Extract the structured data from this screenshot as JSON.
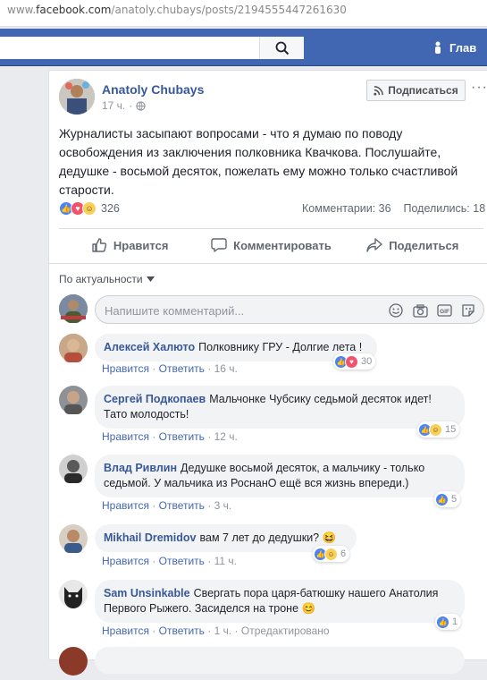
{
  "browser": {
    "url_prefix": "www.",
    "url_host": "facebook.com",
    "url_path": "/anatoly.chubays/posts/2194555447261630"
  },
  "topbar": {
    "search_placeholder": "",
    "nav_home": "Глав"
  },
  "post": {
    "author": "Anatoly Chubays",
    "time": "17 ч.",
    "subscribe_label": "Подписаться",
    "text": "Журналисты засыпают вопросами - что я думаю по поводу освобождения из заключения полковника Квачкова. Послушайте, дедушке - восьмой десяток, пожелать ему можно только счастливой старости.",
    "reaction_count": "326",
    "comments_label": "Комментарии: 36",
    "shares_label": "Поделились: 18",
    "like_label": "Нравится",
    "comment_label": "Комментировать",
    "share_label": "Поделиться"
  },
  "comments_section": {
    "sort_label": "По актуальности",
    "composer_placeholder": "Напишите комментарий..."
  },
  "comments": [
    {
      "name": "Алексей Халюто",
      "text": "Полковнику ГРУ - Долгие лета !",
      "like": "Нравится",
      "reply": "Ответить",
      "time": "16 ч.",
      "reactions": "30",
      "avatar_color": "#b08a6a"
    },
    {
      "name": "Сергей Подкопаев",
      "text": "Мальчонке Чубсику седьмой десяток идет! Тато молодость!",
      "like": "Нравится",
      "reply": "Ответить",
      "time": "12 ч.",
      "reactions": "15",
      "avatar_color": "#7a7d80"
    },
    {
      "name": "Влад Ривлин",
      "text": "Дедушке восьмой десяток, а мальчику - только седьмой. У мальчика из РоснанО ещё вся жизнь впереди.)",
      "like": "Нравится",
      "reply": "Ответить",
      "time": "3 ч.",
      "reactions": "5",
      "avatar_color": "#4a4a4a"
    },
    {
      "name": "Mikhail Dremidov",
      "text": "вам 7 лет до дедушки?",
      "like": "Нравится",
      "reply": "Ответить",
      "time": "11 ч.",
      "reactions": "6",
      "avatar_color": "#a58870"
    },
    {
      "name": "Sam Unsinkable",
      "text": "Свергать пора царя-батюшку нашего Анатолия Первого Рыжего. Засиделся на троне",
      "like": "Нравится",
      "reply": "Ответить",
      "time": "1 ч.",
      "reactions": "1",
      "edited": "Отредактировано",
      "avatar_color": "#333333"
    },
    {
      "name": "",
      "text": "",
      "like": "",
      "reply": "",
      "time": "",
      "reactions": "",
      "avatar_color": "#8b3a2a"
    }
  ],
  "colors": {
    "fb_blue": "#4267b2",
    "link_blue": "#385898",
    "like_blue": "#4a84f7",
    "love_red": "#f2526c",
    "haha_yellow": "#f8d05a"
  }
}
